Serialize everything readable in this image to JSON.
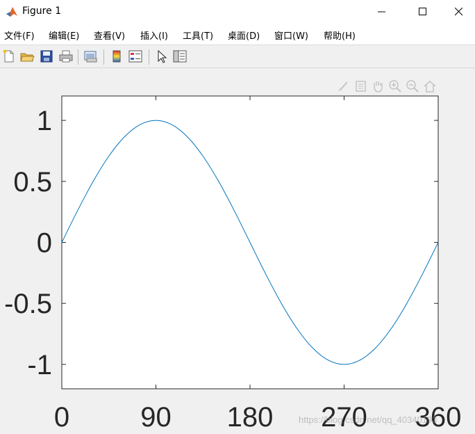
{
  "window": {
    "title": "Figure 1",
    "icon": "matlab-icon",
    "controls": [
      "minimize-icon",
      "maximize-icon",
      "close-icon"
    ]
  },
  "menu": {
    "items": [
      {
        "label": "文件(F)"
      },
      {
        "label": "编辑(E)"
      },
      {
        "label": "查看(V)"
      },
      {
        "label": "插入(I)"
      },
      {
        "label": "工具(T)"
      },
      {
        "label": "桌面(D)"
      },
      {
        "label": "窗口(W)"
      },
      {
        "label": "帮助(H)"
      }
    ]
  },
  "toolbar": {
    "buttons": [
      "new-figure-icon",
      "open-file-icon",
      "save-icon",
      "print-icon",
      "link-plot-icon",
      "insert-colorbar-icon",
      "insert-legend-icon",
      "edit-plot-pointer-icon",
      "property-inspector-icon"
    ]
  },
  "axes_toolbar": {
    "buttons": [
      "brush-icon",
      "data-tip-icon",
      "pan-icon",
      "zoom-in-icon",
      "zoom-out-icon",
      "restore-view-icon"
    ]
  },
  "colors": {
    "line": "#0072bd",
    "axes_bg": "#ffffff",
    "figure_bg": "#f0f0f0"
  },
  "chart_data": {
    "type": "line",
    "title": "",
    "xlabel": "",
    "ylabel": "",
    "xlim": [
      0,
      360
    ],
    "ylim": [
      -1.2,
      1.2
    ],
    "xticks": [
      0,
      90,
      180,
      270,
      360
    ],
    "xtick_labels": [
      "0",
      "90",
      "180",
      "270",
      "360"
    ],
    "yticks": [
      1,
      0.5,
      0,
      -0.5,
      -1
    ],
    "ytick_labels": [
      "1",
      "0.5",
      "0",
      "-0.5",
      "-1"
    ],
    "grid": false,
    "series": [
      {
        "x": [
          0,
          15,
          30,
          45,
          60,
          75,
          90,
          105,
          120,
          135,
          150,
          165,
          180,
          195,
          210,
          225,
          240,
          255,
          270,
          285,
          300,
          315,
          330,
          345,
          360
        ],
        "y": [
          0,
          0.259,
          0.5,
          0.707,
          0.866,
          0.966,
          1,
          0.966,
          0.866,
          0.707,
          0.5,
          0.259,
          0,
          -0.259,
          -0.5,
          -0.707,
          -0.866,
          -0.966,
          -1,
          -0.966,
          -0.866,
          -0.707,
          -0.5,
          -0.259,
          0
        ]
      }
    ]
  },
  "watermark": "https://blog.csdn.net/qq_40340193"
}
